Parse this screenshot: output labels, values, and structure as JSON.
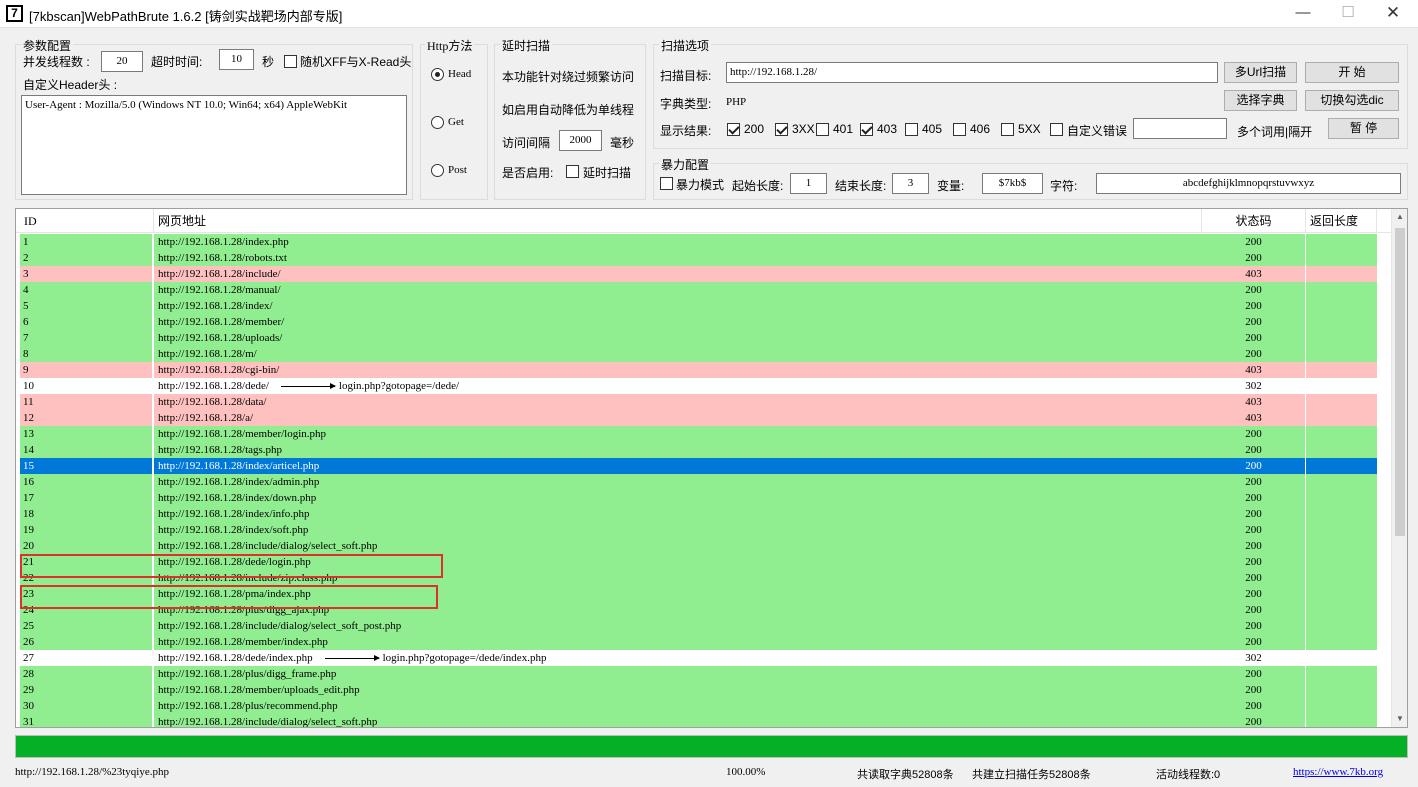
{
  "window": {
    "icon": "7",
    "title": "[7kbscan]WebPathBrute 1.6.2 [铸剑实战靶场内部专版]",
    "minimize": "—",
    "maximize": "☐",
    "close": "✕"
  },
  "params": {
    "legend": "参数配置",
    "threads_label": "并发线程数 :",
    "threads_value": "20",
    "timeout_label": "超时时间:",
    "timeout_value": "10",
    "timeout_unit": "秒",
    "random_xff_label": "随机XFF与X-Read头",
    "header_label": "自定义Header头 :",
    "header_value": "User-Agent : Mozilla/5.0 (Windows NT 10.0; Win64; x64) AppleWebKit"
  },
  "http": {
    "legend": "Http方法",
    "head": "Head",
    "get": "Get",
    "post": "Post"
  },
  "delay": {
    "legend": "延时扫描",
    "desc1": "本功能针对绕过频繁访问",
    "desc2": "如启用自动降低为单线程",
    "interval_label": "访问间隔",
    "interval_value": "2000",
    "interval_unit": "毫秒",
    "enable_label": "是否启用:",
    "enable_check": "延时扫描"
  },
  "scan": {
    "legend": "扫描选项",
    "target_label": "扫描目标:",
    "target_value": "http://192.168.1.28/",
    "dict_type_label": "字典类型:",
    "dict_type_value": "PHP",
    "show_label": "显示结果:",
    "filters": [
      "200",
      "3XX",
      "401",
      "403",
      "405",
      "406",
      "5XX"
    ],
    "filters_checked": [
      true,
      true,
      false,
      true,
      false,
      false,
      false
    ],
    "custom_error_label": "自定义错误",
    "custom_error_value": "",
    "multi_word_label": "多个词用|隔开",
    "btn_multi_url": "多Url扫描",
    "btn_start": "开 始",
    "btn_choose_dict": "选择字典",
    "btn_toggle_dic": "切换勾选dic",
    "btn_pause": "暂 停"
  },
  "brute": {
    "legend": "暴力配置",
    "mode_label": "暴力模式",
    "start_len_label": "起始长度:",
    "start_len_value": "1",
    "end_len_label": "结束长度:",
    "end_len_value": "3",
    "var_label": "变量:",
    "var_value": "$7kb$",
    "chars_label": "字符:",
    "chars_value": "abcdefghijklmnopqrstuvwxyz"
  },
  "table": {
    "columns": [
      "ID",
      "网页地址",
      "状态码",
      "返回长度"
    ],
    "rows": [
      {
        "id": "1",
        "url": "http://192.168.1.28/index.php",
        "status": "200",
        "length": ""
      },
      {
        "id": "2",
        "url": "http://192.168.1.28/robots.txt",
        "status": "200",
        "length": ""
      },
      {
        "id": "3",
        "url": "http://192.168.1.28/include/",
        "status": "403",
        "length": ""
      },
      {
        "id": "4",
        "url": "http://192.168.1.28/manual/",
        "status": "200",
        "length": ""
      },
      {
        "id": "5",
        "url": "http://192.168.1.28/index/",
        "status": "200",
        "length": ""
      },
      {
        "id": "6",
        "url": "http://192.168.1.28/member/",
        "status": "200",
        "length": ""
      },
      {
        "id": "7",
        "url": "http://192.168.1.28/uploads/",
        "status": "200",
        "length": ""
      },
      {
        "id": "8",
        "url": "http://192.168.1.28/m/",
        "status": "200",
        "length": ""
      },
      {
        "id": "9",
        "url": "http://192.168.1.28/cgi-bin/",
        "status": "403",
        "length": ""
      },
      {
        "id": "10",
        "url": "http://192.168.1.28/dede/",
        "redirect": "login.php?gotopage=/dede/",
        "status": "302",
        "length": ""
      },
      {
        "id": "11",
        "url": "http://192.168.1.28/data/",
        "status": "403",
        "length": ""
      },
      {
        "id": "12",
        "url": "http://192.168.1.28/a/",
        "status": "403",
        "length": ""
      },
      {
        "id": "13",
        "url": "http://192.168.1.28/member/login.php",
        "status": "200",
        "length": ""
      },
      {
        "id": "14",
        "url": "http://192.168.1.28/tags.php",
        "status": "200",
        "length": ""
      },
      {
        "id": "15",
        "url": "http://192.168.1.28/index/articel.php",
        "status": "200",
        "length": "",
        "selected": true
      },
      {
        "id": "16",
        "url": "http://192.168.1.28/index/admin.php",
        "status": "200",
        "length": ""
      },
      {
        "id": "17",
        "url": "http://192.168.1.28/index/down.php",
        "status": "200",
        "length": ""
      },
      {
        "id": "18",
        "url": "http://192.168.1.28/index/info.php",
        "status": "200",
        "length": ""
      },
      {
        "id": "19",
        "url": "http://192.168.1.28/index/soft.php",
        "status": "200",
        "length": ""
      },
      {
        "id": "20",
        "url": "http://192.168.1.28/include/dialog/select_soft.php",
        "status": "200",
        "length": ""
      },
      {
        "id": "21",
        "url": "http://192.168.1.28/dede/login.php",
        "status": "200",
        "length": ""
      },
      {
        "id": "22",
        "url": "http://192.168.1.28/include/zip.class.php",
        "status": "200",
        "length": ""
      },
      {
        "id": "23",
        "url": "http://192.168.1.28/pma/index.php",
        "status": "200",
        "length": ""
      },
      {
        "id": "24",
        "url": "http://192.168.1.28/plus/digg_ajax.php",
        "status": "200",
        "length": ""
      },
      {
        "id": "25",
        "url": "http://192.168.1.28/include/dialog/select_soft_post.php",
        "status": "200",
        "length": ""
      },
      {
        "id": "26",
        "url": "http://192.168.1.28/member/index.php",
        "status": "200",
        "length": ""
      },
      {
        "id": "27",
        "url": "http://192.168.1.28/dede/index.php",
        "redirect": "login.php?gotopage=/dede/index.php",
        "status": "302",
        "length": ""
      },
      {
        "id": "28",
        "url": "http://192.168.1.28/plus/digg_frame.php",
        "status": "200",
        "length": ""
      },
      {
        "id": "29",
        "url": "http://192.168.1.28/member/uploads_edit.php",
        "status": "200",
        "length": ""
      },
      {
        "id": "30",
        "url": "http://192.168.1.28/plus/recommend.php",
        "status": "200",
        "length": ""
      },
      {
        "id": "31",
        "url": "http://192.168.1.28/include/dialog/select_soft.php",
        "status": "200",
        "length": ""
      }
    ]
  },
  "progress": {
    "fraction": 1.0
  },
  "status": {
    "current_url": "http://192.168.1.28/%23tyqiye.php",
    "percent": "100.00%",
    "dict_count": "共读取字典52808条",
    "task_count": "共建立扫描任务52808条",
    "active_threads": "活动线程数:0",
    "link": "https://www.7kb.org"
  },
  "colors": {
    "status_200": "#90ee90",
    "status_403": "#ffc0c0",
    "status_302": "#ffffff",
    "selected": "#0078d7",
    "progress": "#06b025",
    "annotation": "#e0302a"
  }
}
